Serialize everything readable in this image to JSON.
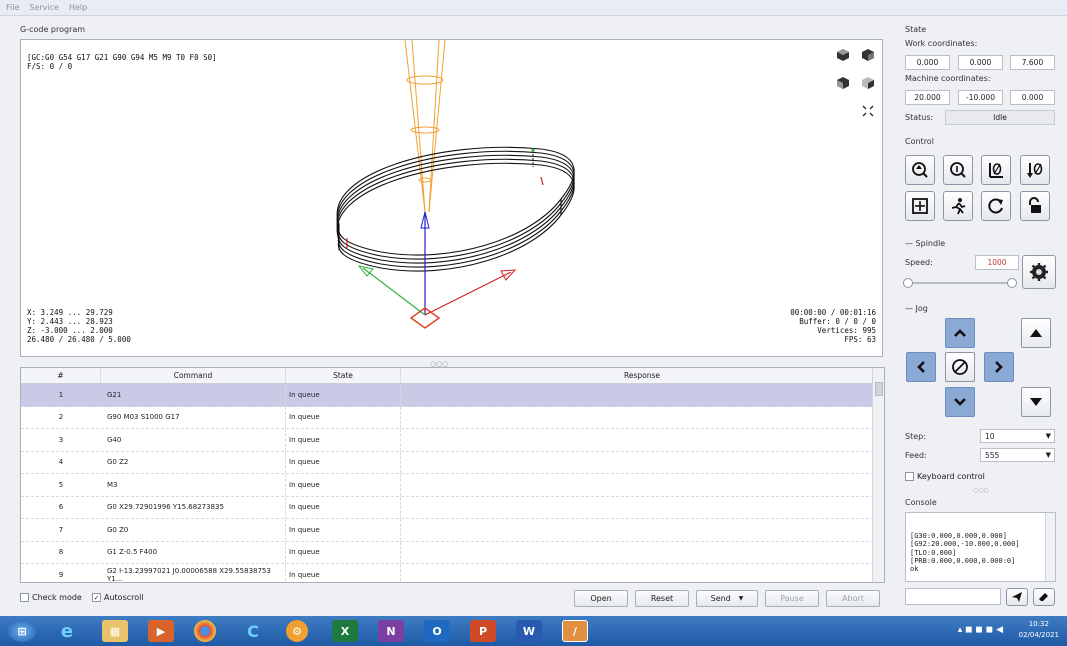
{
  "menu": {
    "items": [
      "File",
      "Service",
      "Help"
    ]
  },
  "viewer": {
    "title": "G-code program",
    "gcode_state": "[GC:G0 G54 G17 G21 G90 G94 M5 M9 T0 F0 S0]",
    "feed_spindle": "F/S: 0 / 0",
    "bounds": {
      "x": "X: 3.249 ... 29.729",
      "y": "Y: 2.443 ... 28.923",
      "z": "Z: -3.000 ... 2.000",
      "size": "26.480 / 26.480 / 5.000"
    },
    "stats": {
      "time": "00:00:00 / 00:01:16",
      "buffer": "Buffer: 0 / 0 / 0",
      "vertices": "Vertices: 995",
      "fps": "FPS: 63"
    }
  },
  "splitter_dots": "○○○",
  "table": {
    "headers": [
      "#",
      "Command",
      "State",
      "Response"
    ],
    "rows": [
      {
        "num": "1",
        "command": "G21",
        "state": "In queue",
        "response": ""
      },
      {
        "num": "2",
        "command": "G90 M03 S1000 G17",
        "state": "In queue",
        "response": ""
      },
      {
        "num": "3",
        "command": "G40",
        "state": "In queue",
        "response": ""
      },
      {
        "num": "4",
        "command": "G0 Z2",
        "state": "In queue",
        "response": ""
      },
      {
        "num": "5",
        "command": "M3",
        "state": "In queue",
        "response": ""
      },
      {
        "num": "6",
        "command": "G0 X29.72901996 Y15.68273835",
        "state": "In queue",
        "response": ""
      },
      {
        "num": "7",
        "command": "G0 Z0",
        "state": "In queue",
        "response": ""
      },
      {
        "num": "8",
        "command": "G1 Z-0.5 F400",
        "state": "In queue",
        "response": ""
      },
      {
        "num": "9",
        "command": "G2 I-13.23997021 J0.00006588 X29.55838753 Y1...",
        "state": "In queue",
        "response": ""
      }
    ]
  },
  "bottom": {
    "check_mode": "Check mode",
    "autoscroll": "Autoscroll",
    "open": "Open",
    "reset": "Reset",
    "send": "Send",
    "pause": "Pause",
    "abort": "Abort"
  },
  "state_panel": {
    "title": "State",
    "work_label": "Work coordinates:",
    "work": [
      "0.000",
      "0.000",
      "7.600"
    ],
    "machine_label": "Machine coordinates:",
    "machine": [
      "20.000",
      "-10.000",
      "0.000"
    ],
    "status_label": "Status:",
    "status": "Idle"
  },
  "control": {
    "title": "Control"
  },
  "spindle": {
    "title": "Spindle",
    "speed_label": "Speed:",
    "speed": "1000",
    "slider_level": 1.0
  },
  "jog": {
    "title": "Jog",
    "step_label": "Step:",
    "step": "10",
    "feed_label": "Feed:",
    "feed": "555",
    "keyboard": "Keyboard control"
  },
  "console": {
    "title": "Console",
    "lines": "[G30:0.000,0.000,0.000]\n[G92:20.000,-10.000,0.000]\n[TLO:0.000]\n[PRB:0.000,0.000,0.000:0]\nok",
    "grip": "○○○"
  },
  "taskbar": {
    "time": "10:32",
    "date": "02/04/2021",
    "apps": [
      "start-orb",
      "internet-explorer",
      "file-explorer",
      "media",
      "chrome",
      "app-c",
      "settings",
      "excel",
      "onenote",
      "outlook",
      "powerpoint",
      "word",
      "candle"
    ]
  },
  "colors": {
    "selection": "#c9cbe6",
    "jog_blue": "#8aa9d4",
    "taskbar": "#2a66b3",
    "spindle_speed": "#c0392b"
  }
}
